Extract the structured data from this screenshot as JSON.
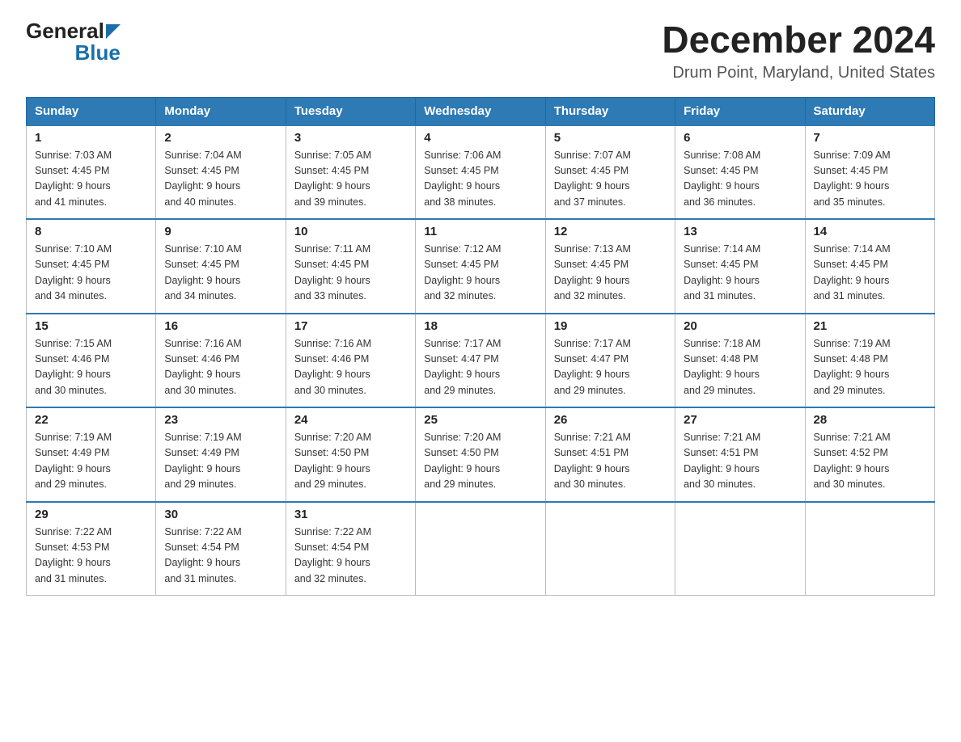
{
  "logo": {
    "general": "General",
    "blue": "Blue"
  },
  "title": "December 2024",
  "subtitle": "Drum Point, Maryland, United States",
  "weekdays": [
    "Sunday",
    "Monday",
    "Tuesday",
    "Wednesday",
    "Thursday",
    "Friday",
    "Saturday"
  ],
  "weeks": [
    [
      {
        "day": "1",
        "sunrise": "7:03 AM",
        "sunset": "4:45 PM",
        "daylight": "9 hours and 41 minutes."
      },
      {
        "day": "2",
        "sunrise": "7:04 AM",
        "sunset": "4:45 PM",
        "daylight": "9 hours and 40 minutes."
      },
      {
        "day": "3",
        "sunrise": "7:05 AM",
        "sunset": "4:45 PM",
        "daylight": "9 hours and 39 minutes."
      },
      {
        "day": "4",
        "sunrise": "7:06 AM",
        "sunset": "4:45 PM",
        "daylight": "9 hours and 38 minutes."
      },
      {
        "day": "5",
        "sunrise": "7:07 AM",
        "sunset": "4:45 PM",
        "daylight": "9 hours and 37 minutes."
      },
      {
        "day": "6",
        "sunrise": "7:08 AM",
        "sunset": "4:45 PM",
        "daylight": "9 hours and 36 minutes."
      },
      {
        "day": "7",
        "sunrise": "7:09 AM",
        "sunset": "4:45 PM",
        "daylight": "9 hours and 35 minutes."
      }
    ],
    [
      {
        "day": "8",
        "sunrise": "7:10 AM",
        "sunset": "4:45 PM",
        "daylight": "9 hours and 34 minutes."
      },
      {
        "day": "9",
        "sunrise": "7:10 AM",
        "sunset": "4:45 PM",
        "daylight": "9 hours and 34 minutes."
      },
      {
        "day": "10",
        "sunrise": "7:11 AM",
        "sunset": "4:45 PM",
        "daylight": "9 hours and 33 minutes."
      },
      {
        "day": "11",
        "sunrise": "7:12 AM",
        "sunset": "4:45 PM",
        "daylight": "9 hours and 32 minutes."
      },
      {
        "day": "12",
        "sunrise": "7:13 AM",
        "sunset": "4:45 PM",
        "daylight": "9 hours and 32 minutes."
      },
      {
        "day": "13",
        "sunrise": "7:14 AM",
        "sunset": "4:45 PM",
        "daylight": "9 hours and 31 minutes."
      },
      {
        "day": "14",
        "sunrise": "7:14 AM",
        "sunset": "4:45 PM",
        "daylight": "9 hours and 31 minutes."
      }
    ],
    [
      {
        "day": "15",
        "sunrise": "7:15 AM",
        "sunset": "4:46 PM",
        "daylight": "9 hours and 30 minutes."
      },
      {
        "day": "16",
        "sunrise": "7:16 AM",
        "sunset": "4:46 PM",
        "daylight": "9 hours and 30 minutes."
      },
      {
        "day": "17",
        "sunrise": "7:16 AM",
        "sunset": "4:46 PM",
        "daylight": "9 hours and 30 minutes."
      },
      {
        "day": "18",
        "sunrise": "7:17 AM",
        "sunset": "4:47 PM",
        "daylight": "9 hours and 29 minutes."
      },
      {
        "day": "19",
        "sunrise": "7:17 AM",
        "sunset": "4:47 PM",
        "daylight": "9 hours and 29 minutes."
      },
      {
        "day": "20",
        "sunrise": "7:18 AM",
        "sunset": "4:48 PM",
        "daylight": "9 hours and 29 minutes."
      },
      {
        "day": "21",
        "sunrise": "7:19 AM",
        "sunset": "4:48 PM",
        "daylight": "9 hours and 29 minutes."
      }
    ],
    [
      {
        "day": "22",
        "sunrise": "7:19 AM",
        "sunset": "4:49 PM",
        "daylight": "9 hours and 29 minutes."
      },
      {
        "day": "23",
        "sunrise": "7:19 AM",
        "sunset": "4:49 PM",
        "daylight": "9 hours and 29 minutes."
      },
      {
        "day": "24",
        "sunrise": "7:20 AM",
        "sunset": "4:50 PM",
        "daylight": "9 hours and 29 minutes."
      },
      {
        "day": "25",
        "sunrise": "7:20 AM",
        "sunset": "4:50 PM",
        "daylight": "9 hours and 29 minutes."
      },
      {
        "day": "26",
        "sunrise": "7:21 AM",
        "sunset": "4:51 PM",
        "daylight": "9 hours and 30 minutes."
      },
      {
        "day": "27",
        "sunrise": "7:21 AM",
        "sunset": "4:51 PM",
        "daylight": "9 hours and 30 minutes."
      },
      {
        "day": "28",
        "sunrise": "7:21 AM",
        "sunset": "4:52 PM",
        "daylight": "9 hours and 30 minutes."
      }
    ],
    [
      {
        "day": "29",
        "sunrise": "7:22 AM",
        "sunset": "4:53 PM",
        "daylight": "9 hours and 31 minutes."
      },
      {
        "day": "30",
        "sunrise": "7:22 AM",
        "sunset": "4:54 PM",
        "daylight": "9 hours and 31 minutes."
      },
      {
        "day": "31",
        "sunrise": "7:22 AM",
        "sunset": "4:54 PM",
        "daylight": "9 hours and 32 minutes."
      },
      null,
      null,
      null,
      null
    ]
  ],
  "labels": {
    "sunrise": "Sunrise:",
    "sunset": "Sunset:",
    "daylight": "Daylight:"
  }
}
